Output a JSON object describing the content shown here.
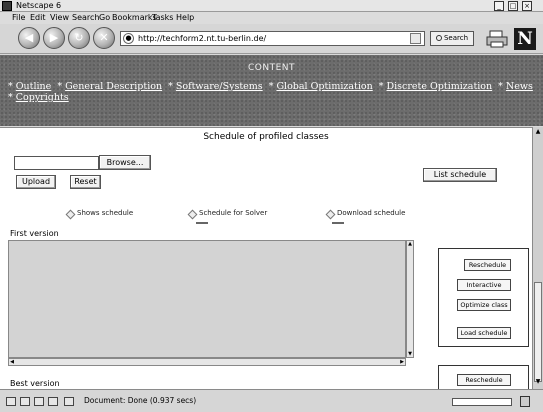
{
  "window": {
    "title": "Netscape 6"
  },
  "menu": [
    "File",
    "Edit",
    "View",
    "Search",
    "Go",
    "Bookmarks",
    "Tasks",
    "Help"
  ],
  "nav": {
    "url": "http://techform2.nt.tu-berlin.de/",
    "search_label": "Search"
  },
  "banner": {
    "title": "CONTENT",
    "links": [
      "Outline",
      "General Description",
      "Software/Systems",
      "Global Optimization",
      "Discrete Optimization",
      "News",
      "Copyrights"
    ]
  },
  "page": {
    "title": "Schedule of profiled classes",
    "file_input_value": "",
    "browse_label": "Browse...",
    "upload_label": "Upload",
    "reset_label": "Reset",
    "list_schedule_label": "List schedule",
    "radio_options": [
      "Shows schedule",
      "Schedule for Solver",
      "Download schedule"
    ],
    "first_version_label": "First version",
    "best_version_label": "Best version",
    "panel_buttons": [
      "Reschedule",
      "Interactive",
      "Optimize class",
      "Load schedule"
    ],
    "panel2_button": "Reschedule"
  },
  "status": {
    "text": "Document: Done (0.937 secs)",
    "progress": 0.0
  }
}
